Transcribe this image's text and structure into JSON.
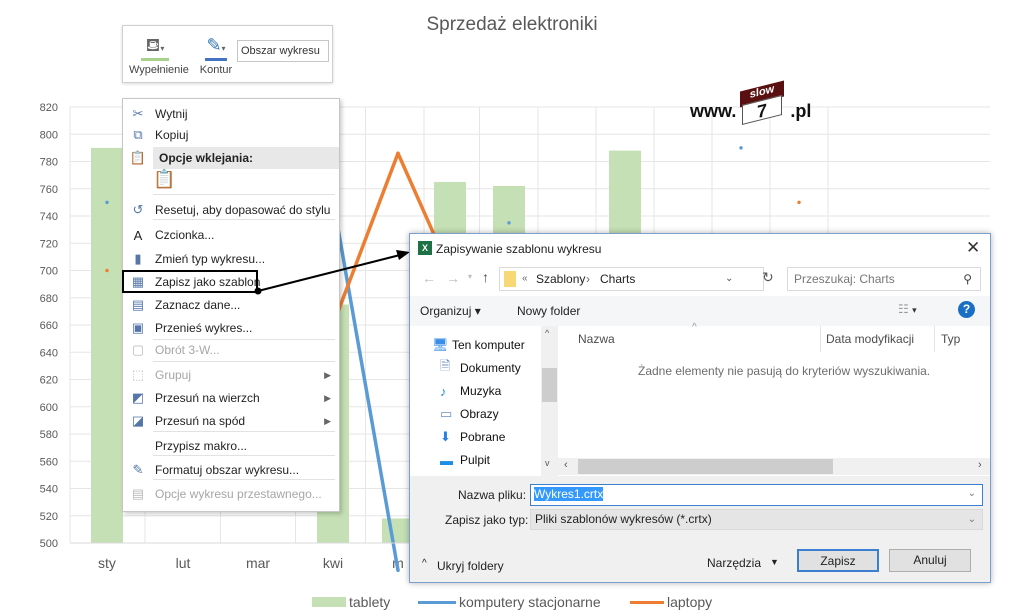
{
  "chart_data": {
    "type": "bar+line",
    "title": "Sprzedaż elektroniki",
    "categories": [
      "sty",
      "lut",
      "mar",
      "kwi",
      "m",
      "",
      "",
      "",
      "",
      "",
      "",
      ""
    ],
    "ylim": [
      500,
      820
    ],
    "yticks": [
      500,
      520,
      540,
      560,
      580,
      600,
      620,
      640,
      660,
      680,
      700,
      720,
      740,
      760,
      780,
      800,
      820
    ],
    "grid": true,
    "legend_position": "bottom",
    "series": [
      {
        "name": "tablety",
        "type": "bar",
        "color": "#c5e0b4",
        "values": [
          790,
          null,
          null,
          675,
          518,
          765,
          762,
          null,
          788,
          null,
          null,
          null
        ]
      },
      {
        "name": "komputery stacjonarne",
        "type": "line",
        "color": "#5b9bd5",
        "values": [
          750,
          null,
          null,
          752,
          480,
          null,
          735,
          null,
          null,
          null,
          790,
          null
        ]
      },
      {
        "name": "laptopy",
        "type": "line",
        "color": "#ed7d31",
        "values": [
          700,
          null,
          null,
          660,
          786,
          700,
          null,
          null,
          null,
          null,
          null,
          750
        ]
      }
    ]
  },
  "logo": {
    "prefix": "www.",
    "roof": "slow",
    "mark": "7",
    "suffix": ".pl"
  },
  "mini_toolbar": {
    "fill_label": "Wypełnienie",
    "outline_label": "Kontur",
    "element_select": "Obszar wykresu"
  },
  "context_menu": {
    "items": [
      {
        "label": "Wytnij",
        "icon": "scissors-icon"
      },
      {
        "label": "Kopiuj",
        "icon": "copy-icon"
      },
      {
        "label": "Opcje wklejania:",
        "icon": "paste-icon"
      },
      {
        "label": "Resetuj, aby dopasować do stylu",
        "icon": "reset-icon"
      },
      {
        "label": "Czcionka...",
        "icon": "font-icon"
      },
      {
        "label": "Zmień typ wykresu...",
        "icon": "chart-type-icon"
      },
      {
        "label": "Zapisz jako szablon",
        "icon": "save-template-icon"
      },
      {
        "label": "Zaznacz dane...",
        "icon": "select-data-icon"
      },
      {
        "label": "Przenieś wykres...",
        "icon": "move-chart-icon"
      },
      {
        "label": "Obrót 3-W...",
        "icon": "rotate-3d-icon"
      },
      {
        "label": "Grupuj",
        "icon": "group-icon"
      },
      {
        "label": "Przesuń na wierzch",
        "icon": "bring-front-icon"
      },
      {
        "label": "Przesuń na spód",
        "icon": "send-back-icon"
      },
      {
        "label": "Przypisz makro...",
        "icon": ""
      },
      {
        "label": "Formatuj obszar wykresu...",
        "icon": "format-icon"
      },
      {
        "label": "Opcje wykresu przestawnego...",
        "icon": "pivot-icon"
      }
    ]
  },
  "dialog": {
    "title": "Zapisywanie szablonu wykresu",
    "path": [
      "«",
      "Szablony",
      "›",
      "Charts"
    ],
    "search_placeholder": "Przeszukaj: Charts",
    "organize": "Organizuj ▾",
    "new_folder": "Nowy folder",
    "nav": [
      "Ten komputer",
      "Dokumenty",
      "Muzyka",
      "Obrazy",
      "Pobrane",
      "Pulpit"
    ],
    "columns": [
      "Nazwa",
      "Data modyfikacji",
      "Typ"
    ],
    "empty_message": "Żadne elementy nie pasują do kryteriów wyszukiwania.",
    "filename_label": "Nazwa pliku:",
    "filename_value": "Wykres1.crtx",
    "type_label": "Zapisz jako typ:",
    "type_value": "Pliki szablonów wykresów (*.crtx)",
    "hide_folders": "Ukryj foldery",
    "tools": "Narzędzia",
    "save": "Zapisz",
    "cancel": "Anuluj"
  }
}
